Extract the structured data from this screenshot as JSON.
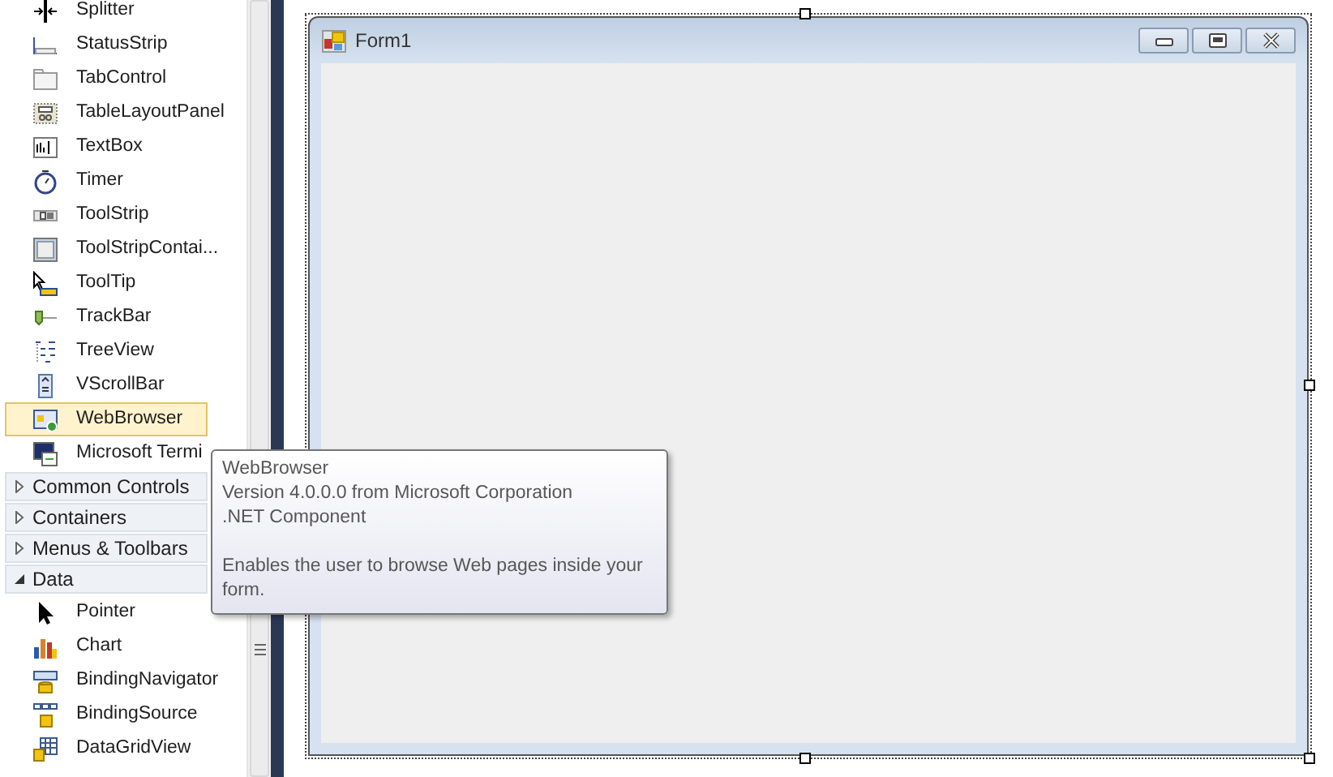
{
  "toolbox": {
    "items": [
      {
        "label": "Splitter",
        "selected": false
      },
      {
        "label": "StatusStrip",
        "selected": false
      },
      {
        "label": "TabControl",
        "selected": false
      },
      {
        "label": "TableLayoutPanel",
        "selected": false
      },
      {
        "label": "TextBox",
        "selected": false
      },
      {
        "label": "Timer",
        "selected": false
      },
      {
        "label": "ToolStrip",
        "selected": false
      },
      {
        "label": "ToolStripContai...",
        "selected": false
      },
      {
        "label": "ToolTip",
        "selected": false
      },
      {
        "label": "TrackBar",
        "selected": false
      },
      {
        "label": "TreeView",
        "selected": false
      },
      {
        "label": "VScrollBar",
        "selected": false
      },
      {
        "label": "WebBrowser",
        "selected": true
      },
      {
        "label": "Microsoft Termi",
        "selected": false
      }
    ],
    "categories": [
      {
        "label": "Common Controls",
        "expanded": false
      },
      {
        "label": "Containers",
        "expanded": false
      },
      {
        "label": "Menus & Toolbars",
        "expanded": false
      },
      {
        "label": "Data",
        "expanded": true,
        "items": [
          {
            "label": "Pointer",
            "selected": false
          },
          {
            "label": "Chart",
            "selected": false
          },
          {
            "label": "BindingNavigator",
            "selected": false
          },
          {
            "label": "BindingSource",
            "selected": false
          },
          {
            "label": "DataGridView",
            "selected": false
          }
        ]
      }
    ]
  },
  "tooltip": {
    "lines": [
      "WebBrowser",
      "Version 4.0.0.0 from Microsoft Corporation",
      ".NET Component"
    ],
    "description": "Enables the user to browse Web pages inside your form."
  },
  "form": {
    "title": "Form1"
  }
}
